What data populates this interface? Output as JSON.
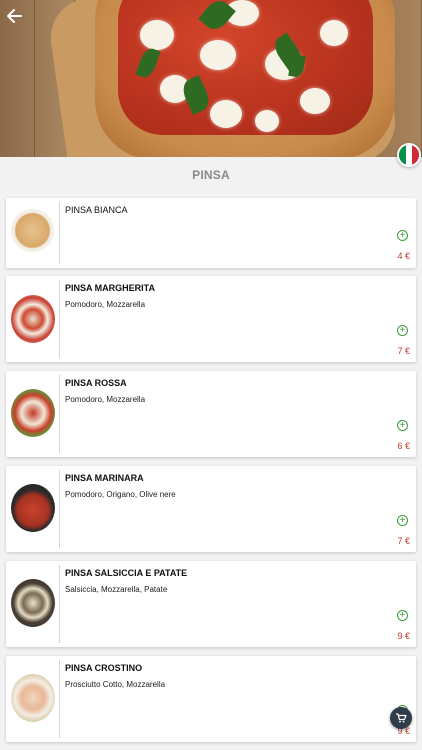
{
  "header": {
    "back_icon": "arrow-left-icon",
    "flag_colors": [
      "#009246",
      "#ffffff",
      "#ce2b37"
    ]
  },
  "section": {
    "title": "PINSA"
  },
  "items": [
    {
      "name": "PINSA BIANCA",
      "description": "",
      "price": "4 €"
    },
    {
      "name": "PINSA MARGHERITA",
      "description": "Pomodoro, Mozzarella",
      "price": "7 €"
    },
    {
      "name": "PINSA ROSSA",
      "description": "Pomodoro, Mozzarella",
      "price": "6 €"
    },
    {
      "name": "PINSA MARINARA",
      "description": "Pomodoro, Origano, Olive nere",
      "price": "7 €"
    },
    {
      "name": "PINSA SALSICCIA E PATATE",
      "description": "Salsiccia, Mozzarella, Patate",
      "price": "9 €"
    },
    {
      "name": "PINSA CROSTINO",
      "description": "Prosciutto Cotto, Mozzarella",
      "price": "9 €"
    }
  ],
  "cart": {
    "icon": "cart-icon"
  },
  "colors": {
    "accent_green": "#3d9c3d",
    "price_red": "#c0392b"
  }
}
